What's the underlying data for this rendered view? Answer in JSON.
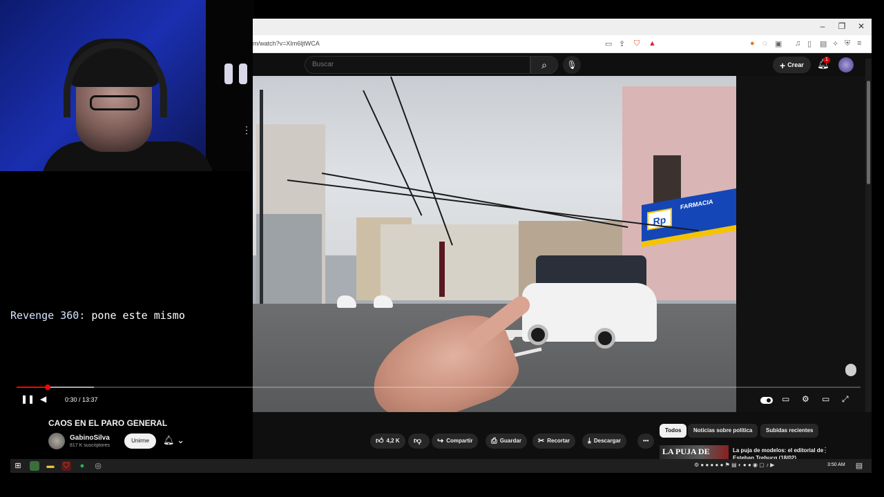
{
  "chat": {
    "username": "Revenge 360:",
    "message": "pone este mismo"
  },
  "browser": {
    "url": "m/watch?v=XIm6ljtWCA",
    "window_controls": {
      "minimize": "–",
      "restore": "❐",
      "close": "✕"
    }
  },
  "youtube": {
    "search_placeholder": "Buscar",
    "create_label": "Crear",
    "notification_count": "1"
  },
  "video": {
    "pharmacy_logo": "Rp",
    "pharmacy_text": "FARMACIA",
    "progress_fraction": 0.037,
    "time_display": "0:30 / 13:37"
  },
  "details": {
    "title": "CAOS EN EL PARO GENERAL",
    "channel_name": "GabinoSilva",
    "subscribers": "817 K suscriptores",
    "join_label": "Unirme",
    "like_count": "4,2 K",
    "share_label": "Compartir",
    "save_label": "Guardar",
    "clip_label": "Recortar",
    "download_label": "Descargar"
  },
  "chips": [
    "Todos",
    "Noticias sobre política",
    "Subidas recientes"
  ],
  "next_video": {
    "thumb_text": "LA PUJA DE",
    "title": "La puja de modelos: el editorial de Esteban Trebucq (18/02)"
  },
  "taskbar": {
    "clock": "3:50 AM"
  }
}
